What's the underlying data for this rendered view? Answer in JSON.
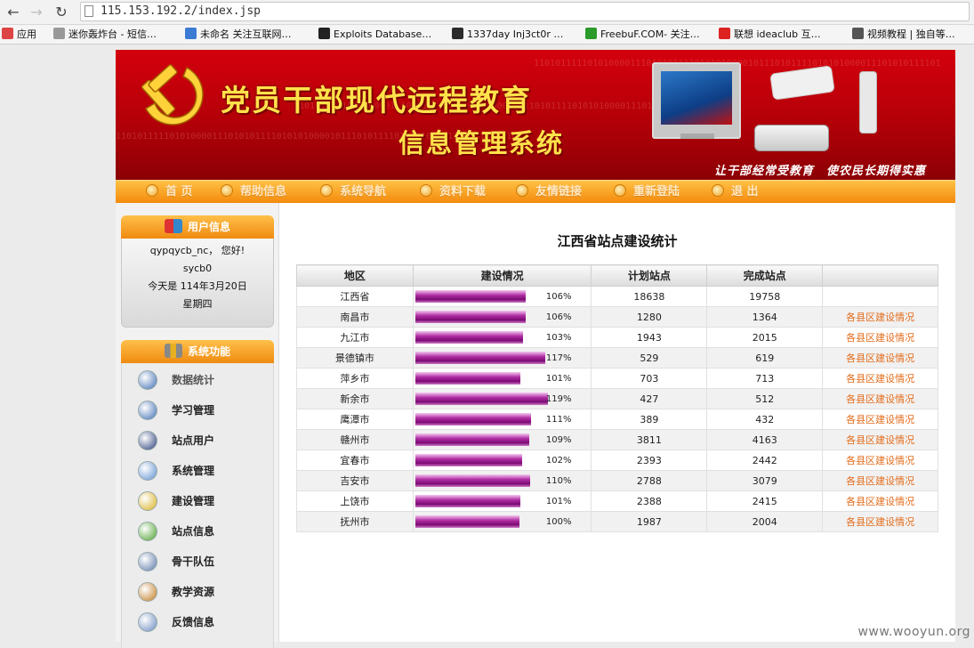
{
  "browser": {
    "url": "115.153.192.2/index.jsp",
    "back_icon": "←",
    "forward_icon": "→",
    "reload_icon": "↻",
    "bookmarks": [
      {
        "label": "应用",
        "color": "#d44"
      },
      {
        "label": "迷你轰炸台 - 短信…",
        "color": "#999"
      },
      {
        "label": "未命名 关注互联网…",
        "color": "#3b7bd4"
      },
      {
        "label": "Exploits Database…",
        "color": "#222"
      },
      {
        "label": "1337day Inj3ct0r …",
        "color": "#2b2b2b"
      },
      {
        "label": "FreebuF.COM- 关注…",
        "color": "#2a9a2a"
      },
      {
        "label": "联想 ideaclub 互…",
        "color": "#d22"
      },
      {
        "label": "视频教程 | 独自等…",
        "color": "#555"
      }
    ]
  },
  "banner": {
    "title_line1": "党员干部现代远程教育",
    "title_line2": "信息管理系统",
    "slogan": "让干部经常受教育　使农民长期得实惠",
    "binary_text": "1101011111010100001110101011110101010000101110101111010101000011101010111101"
  },
  "nav": {
    "items": [
      "首 页",
      "帮助信息",
      "系统导航",
      "资料下载",
      "友情链接",
      "重新登陆",
      "退 出"
    ]
  },
  "user_panel": {
    "title": "用户信息",
    "greeting": "qypqycb_nc， 您好!",
    "username": "sycb0",
    "date": "今天是 114年3月20日",
    "weekday": "星期四"
  },
  "func_panel": {
    "title": "系统功能",
    "items": [
      {
        "label": "数据统计",
        "icon": "globe-icon",
        "color": "#3f6fb5"
      },
      {
        "label": "学习管理",
        "icon": "cursor-icon",
        "color": "#3f6fb5"
      },
      {
        "label": "站点用户",
        "icon": "users-icon",
        "color": "#2a3f7a"
      },
      {
        "label": "系统管理",
        "icon": "gear-icon",
        "color": "#5f8fd0"
      },
      {
        "label": "建设管理",
        "icon": "compass-icon",
        "color": "#d8b020"
      },
      {
        "label": "站点信息",
        "icon": "bar-chart-icon",
        "color": "#4aa02a"
      },
      {
        "label": "骨干队伍",
        "icon": "calculator-icon",
        "color": "#5a78a8"
      },
      {
        "label": "教学资源",
        "icon": "ruler-icon",
        "color": "#c07a20"
      },
      {
        "label": "反馈信息",
        "icon": "mail-icon",
        "color": "#6a8ac0"
      }
    ]
  },
  "table": {
    "title": "江西省站点建设统计",
    "headers": [
      "地区",
      "建设情况",
      "计划站点",
      "完成站点",
      ""
    ],
    "link_label": "各县区建设情况",
    "rows": [
      {
        "region": "江西省",
        "progress": 106,
        "pct_label": "106%",
        "planned": "18638",
        "completed": "19758",
        "link": false
      },
      {
        "region": "南昌市",
        "progress": 106,
        "pct_label": "106%",
        "planned": "1280",
        "completed": "1364",
        "link": true
      },
      {
        "region": "九江市",
        "progress": 103,
        "pct_label": "103%",
        "planned": "1943",
        "completed": "2015",
        "link": true
      },
      {
        "region": "景德镇市",
        "progress": 117,
        "pct_label": "117%",
        "planned": "529",
        "completed": "619",
        "link": true
      },
      {
        "region": "萍乡市",
        "progress": 101,
        "pct_label": "101%",
        "planned": "703",
        "completed": "713",
        "link": true
      },
      {
        "region": "新余市",
        "progress": 119,
        "pct_label": "119%",
        "planned": "427",
        "completed": "512",
        "link": true
      },
      {
        "region": "鹰潭市",
        "progress": 111,
        "pct_label": "111%",
        "planned": "389",
        "completed": "432",
        "link": true
      },
      {
        "region": "赣州市",
        "progress": 109,
        "pct_label": "109%",
        "planned": "3811",
        "completed": "4163",
        "link": true
      },
      {
        "region": "宜春市",
        "progress": 102,
        "pct_label": "102%",
        "planned": "2393",
        "completed": "2442",
        "link": true
      },
      {
        "region": "吉安市",
        "progress": 110,
        "pct_label": "110%",
        "planned": "2788",
        "completed": "3079",
        "link": true
      },
      {
        "region": "上饶市",
        "progress": 101,
        "pct_label": "101%",
        "planned": "2388",
        "completed": "2415",
        "link": true
      },
      {
        "region": "抚州市",
        "progress": 100,
        "pct_label": "100%",
        "planned": "1987",
        "completed": "2004",
        "link": true
      }
    ]
  },
  "watermark": "www.wooyun.org"
}
